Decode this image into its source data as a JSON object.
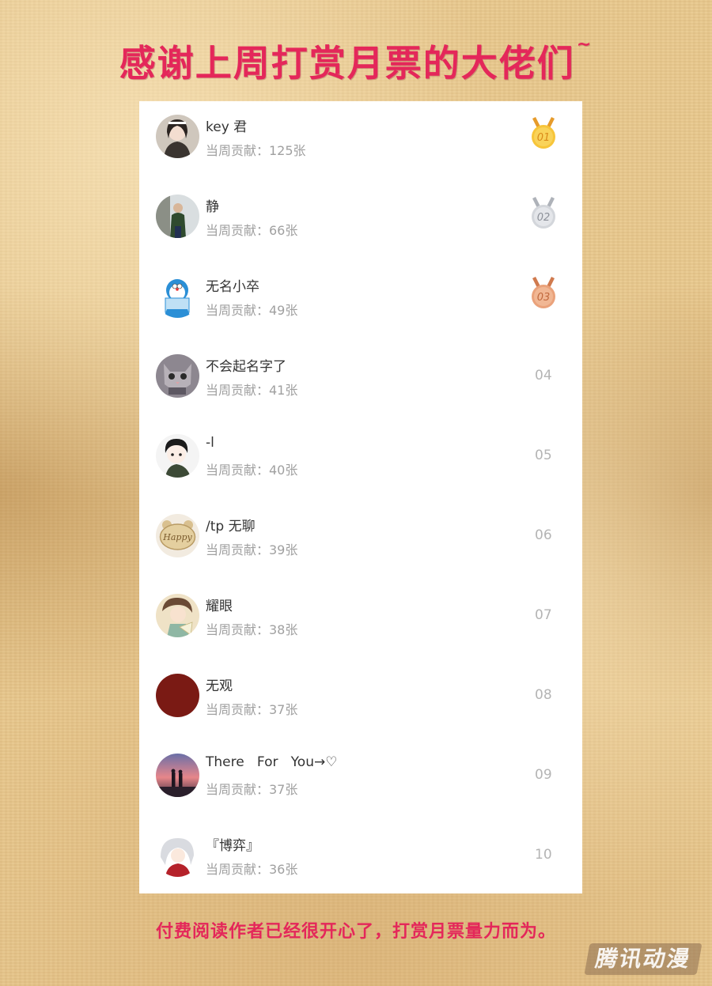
{
  "title": "感谢上周打赏月票的大佬们",
  "title_suffix": "~",
  "contribution_label": "当周贡献：",
  "unit": "张",
  "footer": "付费阅读作者已经很开心了，打赏月票量力而为。",
  "watermark": "腾讯动漫",
  "colors": {
    "accent": "#e4275a",
    "gold": "#f2b43a",
    "silver": "#c9ccd2",
    "bronze": "#e2986e"
  },
  "ranking": [
    {
      "name": "key 君",
      "contribution": "当周贡献：125张",
      "rank": "01",
      "medal": "gold",
      "avatar_icon": "girl-avatar-icon"
    },
    {
      "name": "静",
      "contribution": "当周贡献：66张",
      "rank": "02",
      "medal": "silver",
      "avatar_icon": "person-photo-avatar-icon"
    },
    {
      "name": "无名小卒",
      "contribution": "当周贡献：49张",
      "rank": "03",
      "medal": "bronze",
      "avatar_icon": "doraemon-avatar-icon"
    },
    {
      "name": "不会起名字了",
      "contribution": "当周贡献：41张",
      "rank": "04",
      "medal": "",
      "avatar_icon": "cat-avatar-icon"
    },
    {
      "name": "-l",
      "contribution": "当周贡献：40张",
      "rank": "05",
      "medal": "",
      "avatar_icon": "anime-boy-avatar-icon"
    },
    {
      "name": "/tp 无聊",
      "contribution": "当周贡献：39张",
      "rank": "06",
      "medal": "",
      "avatar_icon": "happy-bear-avatar-icon"
    },
    {
      "name": "耀眼",
      "contribution": "当周贡献：38张",
      "rank": "07",
      "medal": "",
      "avatar_icon": "anime-character-avatar-icon"
    },
    {
      "name": "无观",
      "contribution": "当周贡献：37张",
      "rank": "08",
      "medal": "",
      "avatar_icon": "dark-red-avatar-icon"
    },
    {
      "name": "There   For   You→♡",
      "contribution": "当周贡献：37张",
      "rank": "09",
      "medal": "",
      "avatar_icon": "sunset-couple-avatar-icon"
    },
    {
      "name": "『博弈』",
      "contribution": "当周贡献：36张",
      "rank": "10",
      "medal": "",
      "avatar_icon": "white-hair-anime-avatar-icon"
    }
  ]
}
